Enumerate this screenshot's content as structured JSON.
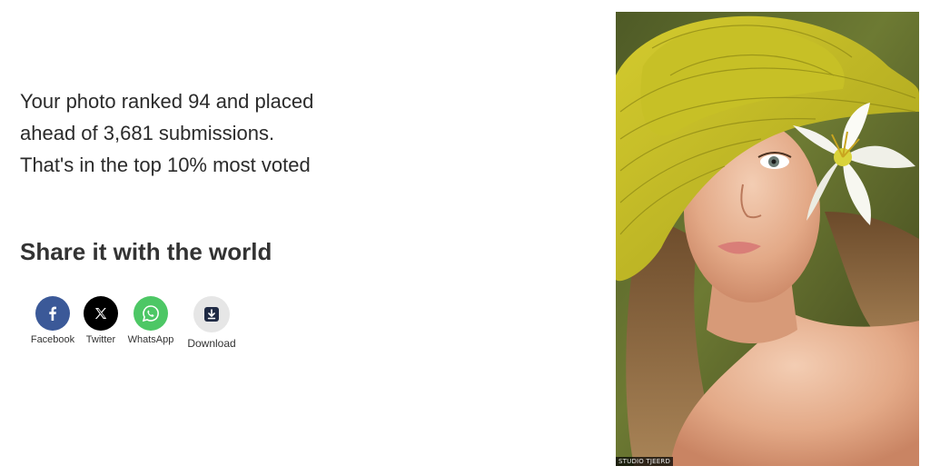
{
  "result": {
    "line1": "Your photo ranked 94 and placed",
    "line2": "ahead of 3,681 submissions.",
    "line3": "That's in the top 10% most voted"
  },
  "share": {
    "title": "Share it with the world",
    "buttons": [
      {
        "label": "Facebook",
        "icon": "facebook-icon",
        "color": "#3b5998"
      },
      {
        "label": "Twitter",
        "icon": "x-icon",
        "color": "#000000"
      },
      {
        "label": "WhatsApp",
        "icon": "whatsapp-icon",
        "color": "#4dc765"
      },
      {
        "label": "Download",
        "icon": "download-icon",
        "color": "#e6e6e6"
      }
    ]
  },
  "photo": {
    "watermark": "STUDIO TJEERD"
  }
}
